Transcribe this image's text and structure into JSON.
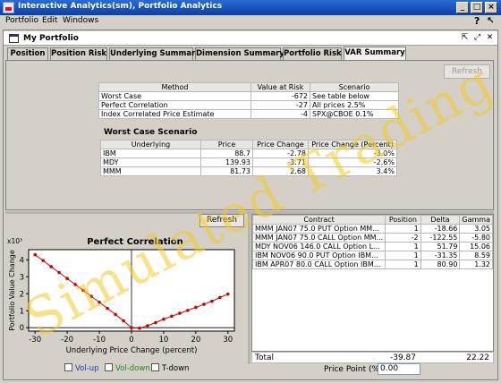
{
  "window": {
    "title": "Interactive Analytics(sm), Portfolio Analytics",
    "min": "_",
    "max": "□",
    "close": "×"
  },
  "menu": {
    "items": [
      "Portfolio",
      "Edit",
      "Windows"
    ],
    "help": "?"
  },
  "inner": {
    "title": "My Portfolio"
  },
  "tabs": [
    "Position",
    "Position Risk",
    "Underlying Summary",
    "Dimension Summary",
    "Portfolio Risk",
    "VAR Summary"
  ],
  "active_tab": "VAR Summary",
  "refresh_top": "Refresh",
  "method_table": {
    "headers": [
      "Method",
      "Value at Risk",
      "Scenario"
    ],
    "rows": [
      [
        "Worst Case",
        "-672",
        "See table below"
      ],
      [
        "Perfect Correlation",
        "-27",
        "All prices  2.5%"
      ],
      [
        "Index Correlated Price Estimate",
        "-4",
        "SPX@CBOE  0.1%"
      ]
    ]
  },
  "worst_case": {
    "title": "Worst Case Scenario",
    "headers": [
      "Underlying",
      "Price",
      "Price Change",
      "Price Change (Percent)"
    ],
    "rows": [
      [
        "IBM",
        "88.7",
        "-2.78",
        "-3.0%"
      ],
      [
        "MDY",
        "139.93",
        "-3.71",
        "-2.6%"
      ],
      [
        "MMM",
        "81.73",
        "2.68",
        "3.4%"
      ]
    ]
  },
  "refresh_bottom": "Refresh",
  "positions": {
    "headers": [
      "Contract",
      "Position",
      "Delta",
      "Gamma"
    ],
    "rows": [
      [
        "MMM JAN07 75.0 PUT Option MM...",
        "1",
        "-18.66",
        "3.05"
      ],
      [
        "MMM JAN07 75.0 CALL Option MM...",
        "-2",
        "-122.55",
        "-5.80"
      ],
      [
        "MDY NOV06 146.0 CALL Option L...",
        "1",
        "51.79",
        "15.06"
      ],
      [
        "IBM NOV06 90.0 PUT Option IBM...",
        "1",
        "-31.35",
        "8.59"
      ],
      [
        "IBM APR07 80.0 CALL Option IBM...",
        "1",
        "80.90",
        "1.32"
      ]
    ],
    "total_label": "Total",
    "total_delta": "-39.87",
    "total_gamma": "22.22"
  },
  "price_point": {
    "label": "Price Point (%)",
    "value": "0.00"
  },
  "legend": [
    "Vol-up",
    "Vol-down",
    "T-down"
  ],
  "colors": {
    "line": "#cc0000",
    "vol_up": "#1a3bd1",
    "vol_down": "#1a8a1a",
    "watermark": "#f0c828"
  },
  "watermark": "Simulated Trading",
  "chart_data": {
    "type": "line",
    "title": "Perfect Correlation",
    "xlabel": "Underlying Price Change (percent)",
    "ylabel": "Portfolio Value Change",
    "y_exponent": "x10³",
    "xlim": [
      -32,
      32
    ],
    "ylim": [
      -0.2,
      4.6
    ],
    "xticks": [
      -30,
      -20,
      -10,
      0,
      10,
      20,
      30
    ],
    "yticks": [
      0,
      1,
      2,
      3,
      4
    ],
    "series": [
      {
        "x": [
          -30,
          -27.5,
          -25,
          -22.5,
          -20,
          -17.5,
          -15,
          -12.5,
          -10,
          -7.5,
          -5,
          -2.5,
          0,
          2.5,
          5,
          7.5,
          10,
          12.5,
          15,
          17.5,
          20,
          22.5,
          25,
          27.5,
          30
        ],
        "y": [
          4.3,
          3.96,
          3.6,
          3.25,
          2.9,
          2.55,
          2.2,
          1.85,
          1.5,
          1.14,
          0.78,
          0.41,
          0.0,
          -0.03,
          0.12,
          0.3,
          0.5,
          0.68,
          0.85,
          1.02,
          1.2,
          1.38,
          1.56,
          1.78,
          1.98
        ]
      }
    ]
  }
}
